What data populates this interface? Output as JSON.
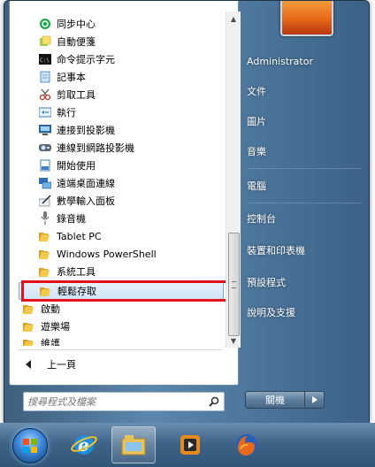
{
  "program_list": {
    "items": [
      {
        "label": "同步中心",
        "icon": "sync-center-icon"
      },
      {
        "label": "自動便箋",
        "icon": "sticky-notes-icon"
      },
      {
        "label": "命令提示字元",
        "icon": "command-prompt-icon"
      },
      {
        "label": "記事本",
        "icon": "notepad-icon"
      },
      {
        "label": "剪取工具",
        "icon": "snipping-tool-icon"
      },
      {
        "label": "執行",
        "icon": "run-icon"
      },
      {
        "label": "連接到投影機",
        "icon": "projector-icon"
      },
      {
        "label": "連線到網路投影機",
        "icon": "network-projector-icon"
      },
      {
        "label": "開始使用",
        "icon": "getting-started-icon"
      },
      {
        "label": "遠端桌面連線",
        "icon": "remote-desktop-icon"
      },
      {
        "label": "數學輸入面板",
        "icon": "math-input-icon"
      },
      {
        "label": "錄音機",
        "icon": "sound-recorder-icon"
      },
      {
        "label": "Tablet PC",
        "icon": "folder-icon"
      },
      {
        "label": "Windows PowerShell",
        "icon": "folder-icon"
      },
      {
        "label": "系統工具",
        "icon": "folder-icon"
      },
      {
        "label": "輕鬆存取",
        "icon": "folder-icon"
      },
      {
        "label": "啟動",
        "icon": "folder-icon"
      },
      {
        "label": "遊樂場",
        "icon": "folder-icon"
      },
      {
        "label": "維護",
        "icon": "folder-icon"
      }
    ],
    "back_label": "上一頁"
  },
  "search": {
    "placeholder": "搜尋程式及檔案"
  },
  "right_pane": {
    "items": [
      "Administrator",
      "文件",
      "圖片",
      "音樂",
      "電腦",
      "控制台",
      "裝置和印表機",
      "預設程式",
      "說明及支援"
    ]
  },
  "shutdown": {
    "label": "關機"
  },
  "taskbar": {
    "icons": [
      "start-orb-icon",
      "internet-explorer-icon",
      "windows-explorer-icon",
      "media-player-icon",
      "firefox-icon"
    ]
  },
  "colors": {
    "highlight_border": "#e3131b",
    "menu_blue": "#3b6286"
  }
}
